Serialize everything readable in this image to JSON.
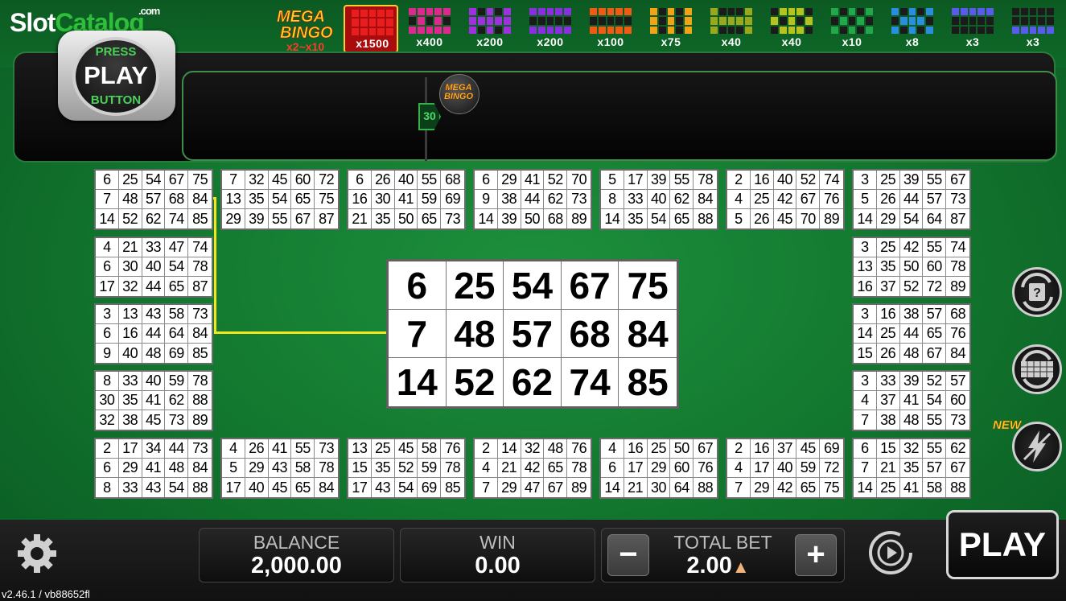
{
  "brand": {
    "logo_part1": "Slot",
    "logo_part2": "Catalog",
    "logo_suffix": ".com"
  },
  "mega_bingo": {
    "line1": "MEGA",
    "line2": "BINGO",
    "multiplier_range": "x2~x10"
  },
  "patterns": [
    {
      "multiplier": "x1500",
      "color": "#e81d1d",
      "active": true
    },
    {
      "multiplier": "x400",
      "color": "#e0278f"
    },
    {
      "multiplier": "x200",
      "color": "#a02fe0"
    },
    {
      "multiplier": "x200",
      "color": "#8a2fe0"
    },
    {
      "multiplier": "x100",
      "color": "#f25a14"
    },
    {
      "multiplier": "x75",
      "color": "#f2a414"
    },
    {
      "multiplier": "x40",
      "color": "#9aa81d"
    },
    {
      "multiplier": "x40",
      "color": "#b8c21d"
    },
    {
      "multiplier": "x10",
      "color": "#22a84a"
    },
    {
      "multiplier": "x8",
      "color": "#2a8ee0"
    },
    {
      "multiplier": "x3",
      "color": "#5a5aee"
    },
    {
      "multiplier": "x3",
      "color": "#5a5aee"
    }
  ],
  "press_play": {
    "top": "PRESS",
    "middle": "PLAY",
    "bottom": "BUTTON"
  },
  "ball_count": "30",
  "mega_ball": {
    "line1": "MEGA",
    "line2": "BINGO"
  },
  "cards": [
    [
      "6",
      "25",
      "54",
      "67",
      "75",
      "7",
      "48",
      "57",
      "68",
      "84",
      "14",
      "52",
      "62",
      "74",
      "85"
    ],
    [
      "7",
      "32",
      "45",
      "60",
      "72",
      "13",
      "35",
      "54",
      "65",
      "75",
      "29",
      "39",
      "55",
      "67",
      "87"
    ],
    [
      "6",
      "26",
      "40",
      "55",
      "68",
      "16",
      "30",
      "41",
      "59",
      "69",
      "21",
      "35",
      "50",
      "65",
      "73"
    ],
    [
      "6",
      "29",
      "41",
      "52",
      "70",
      "9",
      "38",
      "44",
      "62",
      "73",
      "14",
      "39",
      "50",
      "68",
      "89"
    ],
    [
      "5",
      "17",
      "39",
      "55",
      "78",
      "8",
      "33",
      "40",
      "62",
      "84",
      "14",
      "35",
      "54",
      "65",
      "88"
    ],
    [
      "2",
      "16",
      "40",
      "52",
      "74",
      "4",
      "25",
      "42",
      "67",
      "76",
      "5",
      "26",
      "45",
      "70",
      "89"
    ],
    [
      "3",
      "25",
      "39",
      "55",
      "67",
      "5",
      "26",
      "44",
      "57",
      "73",
      "14",
      "29",
      "54",
      "64",
      "87"
    ],
    [
      "4",
      "21",
      "33",
      "47",
      "74",
      "6",
      "30",
      "40",
      "54",
      "78",
      "17",
      "32",
      "44",
      "65",
      "87"
    ],
    [
      "3",
      "25",
      "42",
      "55",
      "74",
      "13",
      "35",
      "50",
      "60",
      "78",
      "16",
      "37",
      "52",
      "72",
      "89"
    ],
    [
      "3",
      "13",
      "43",
      "58",
      "73",
      "6",
      "16",
      "44",
      "64",
      "84",
      "9",
      "40",
      "48",
      "69",
      "85"
    ],
    [
      "3",
      "16",
      "38",
      "57",
      "68",
      "14",
      "25",
      "44",
      "65",
      "76",
      "15",
      "26",
      "48",
      "67",
      "84"
    ],
    [
      "8",
      "33",
      "40",
      "59",
      "78",
      "30",
      "35",
      "41",
      "62",
      "88",
      "32",
      "38",
      "45",
      "73",
      "89"
    ],
    [
      "3",
      "33",
      "39",
      "52",
      "57",
      "4",
      "37",
      "41",
      "54",
      "60",
      "7",
      "38",
      "48",
      "55",
      "73"
    ],
    [
      "2",
      "17",
      "34",
      "44",
      "73",
      "6",
      "29",
      "41",
      "48",
      "84",
      "8",
      "33",
      "43",
      "54",
      "88"
    ],
    [
      "4",
      "26",
      "41",
      "55",
      "73",
      "5",
      "29",
      "43",
      "58",
      "78",
      "17",
      "40",
      "45",
      "65",
      "84"
    ],
    [
      "13",
      "25",
      "45",
      "58",
      "76",
      "15",
      "35",
      "52",
      "59",
      "78",
      "17",
      "43",
      "54",
      "69",
      "85"
    ],
    [
      "2",
      "14",
      "32",
      "48",
      "76",
      "4",
      "21",
      "42",
      "65",
      "78",
      "7",
      "29",
      "47",
      "67",
      "89"
    ],
    [
      "4",
      "16",
      "25",
      "50",
      "67",
      "6",
      "17",
      "29",
      "60",
      "76",
      "14",
      "21",
      "30",
      "64",
      "88"
    ],
    [
      "2",
      "16",
      "37",
      "45",
      "69",
      "4",
      "17",
      "40",
      "59",
      "72",
      "7",
      "29",
      "42",
      "65",
      "75"
    ],
    [
      "6",
      "15",
      "32",
      "55",
      "62",
      "7",
      "21",
      "35",
      "57",
      "67",
      "14",
      "25",
      "41",
      "58",
      "88"
    ]
  ],
  "big_card": [
    "6",
    "25",
    "54",
    "67",
    "75",
    "7",
    "48",
    "57",
    "68",
    "84",
    "14",
    "52",
    "62",
    "74",
    "85"
  ],
  "side": {
    "new_label": "NEW"
  },
  "bottom": {
    "balance_label": "BALANCE",
    "balance_value": "2,000.00",
    "win_label": "WIN",
    "win_value": "0.00",
    "bet_label": "TOTAL BET",
    "bet_value": "2.00",
    "minus": "−",
    "plus": "+",
    "play_label": "PLAY"
  },
  "version": "v2.46.1 / vb88652fl"
}
